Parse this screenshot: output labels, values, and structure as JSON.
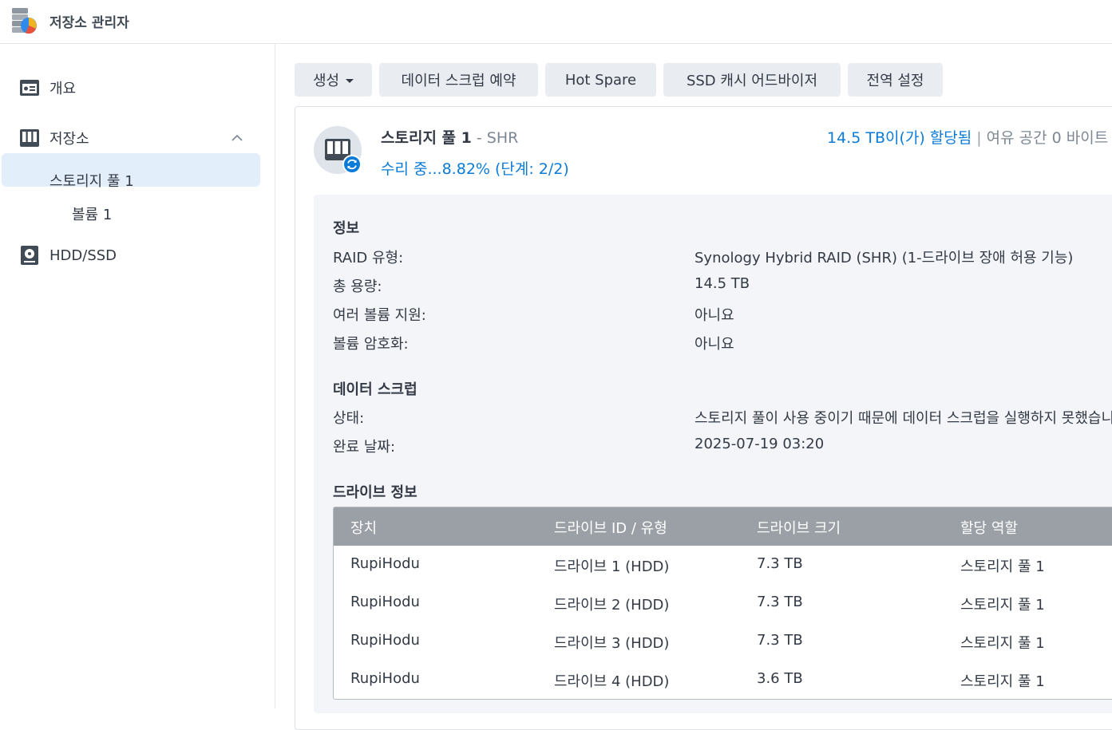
{
  "app": {
    "title": "저장소 관리자"
  },
  "sidebar": {
    "items": [
      {
        "label": "개요",
        "icon": "overview-icon"
      },
      {
        "label": "저장소",
        "icon": "storage-icon",
        "expanded": true
      },
      {
        "label": "스토리지 풀 1"
      },
      {
        "label": "볼륨 1",
        "selected": true
      },
      {
        "label": "HDD/SSD",
        "icon": "drive-icon"
      }
    ]
  },
  "toolbar": {
    "create_label": "생성",
    "scrub_label": "데이터 스크럽 예약",
    "hotspare_label": "Hot Spare",
    "ssd_label": "SSD 캐시 어드바이저",
    "global_label": "전역 설정"
  },
  "pool": {
    "name": "스토리지 풀 1",
    "type_sep": " - ",
    "type": "SHR",
    "status": "수리 중...8.82% (단계: 2/2)",
    "allocated": "14.5 TB이(가) 할당됨",
    "separator": "|",
    "free": "여유 공간 0 바이트"
  },
  "info": {
    "title": "정보",
    "rows": [
      {
        "label": "RAID 유형:",
        "value": "Synology Hybrid RAID (SHR) (1-드라이브 장애 허용 기능)"
      },
      {
        "label": "총 용량:",
        "value": "14.5 TB"
      },
      {
        "label": "여러 볼륨 지원:",
        "value": "아니요"
      },
      {
        "label": "볼륨 암호화:",
        "value": "아니요"
      }
    ]
  },
  "scrub": {
    "title": "데이터 스크럽",
    "rows": [
      {
        "label": "상태:",
        "value": "스토리지 풀이 사용 중이기 때문에 데이터 스크럽을 실행하지 못했습니다."
      },
      {
        "label": "완료 날짜:",
        "value": "2025-07-19 03:20"
      }
    ]
  },
  "drives": {
    "title": "드라이브 정보",
    "columns": [
      "장치",
      "드라이브 ID / 유형",
      "드라이브 크기",
      "할당 역할"
    ],
    "rows": [
      [
        "RupiHodu",
        "드라이브 1 (HDD)",
        "7.3 TB",
        "스토리지 풀 1"
      ],
      [
        "RupiHodu",
        "드라이브 2 (HDD)",
        "7.3 TB",
        "스토리지 풀 1"
      ],
      [
        "RupiHodu",
        "드라이브 3 (HDD)",
        "7.3 TB",
        "스토리지 풀 1"
      ],
      [
        "RupiHodu",
        "드라이브 4 (HDD)",
        "3.6 TB",
        "스토리지 풀 1"
      ]
    ]
  },
  "colors": {
    "accent": "#0b7bd8",
    "selected_bg": "#e3eefb",
    "table_header": "#9aa0a6",
    "panel_bg": "#f3f5f8"
  }
}
